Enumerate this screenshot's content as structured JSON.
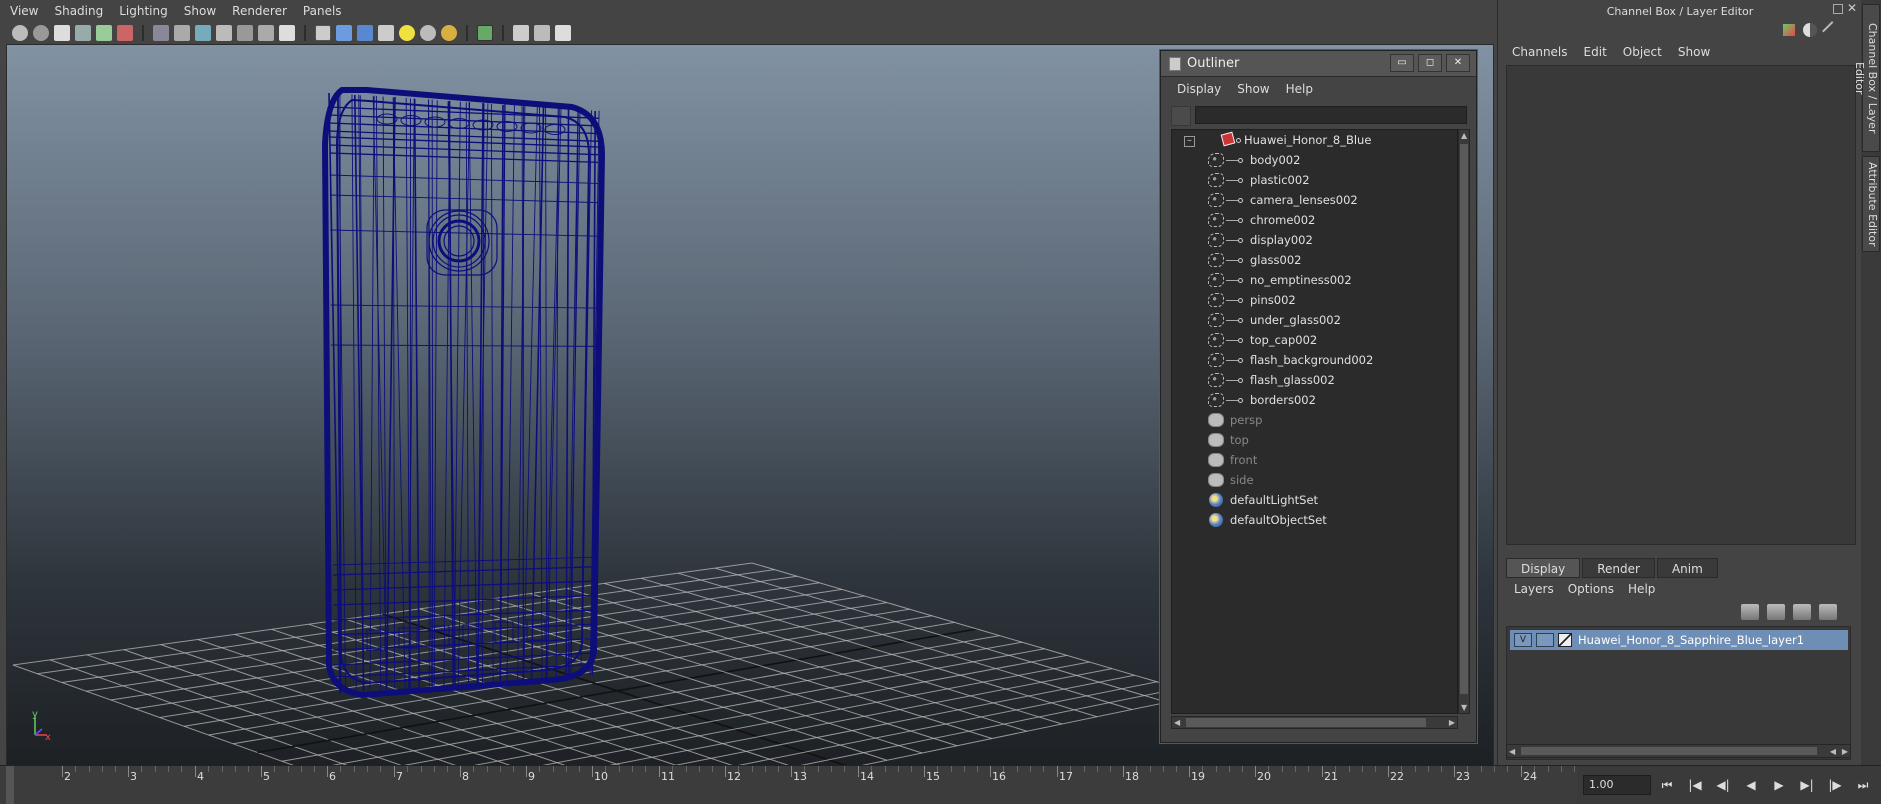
{
  "viewport": {
    "menu": [
      "View",
      "Shading",
      "Lighting",
      "Show",
      "Renderer",
      "Panels"
    ],
    "colors": {
      "wireframe": "#0d0e7a",
      "grid": "#bbbbbb",
      "grid_dark": "#111111"
    }
  },
  "outliner": {
    "title": "Outliner",
    "menu": [
      "Display",
      "Show",
      "Help"
    ],
    "search_value": "",
    "collapse_symbol": "–",
    "window_buttons": [
      "▭",
      "◻",
      "✕"
    ],
    "root": "Huawei_Honor_8_Blue",
    "children": [
      "body002",
      "plastic002",
      "camera_lenses002",
      "chrome002",
      "display002",
      "glass002",
      "no_emptiness002",
      "pins002",
      "under_glass002",
      "top_cap002",
      "flash_background002",
      "flash_glass002",
      "borders002"
    ],
    "cameras": [
      "persp",
      "top",
      "front",
      "side"
    ],
    "sets": [
      "defaultLightSet",
      "defaultObjectSet"
    ]
  },
  "channel_box": {
    "title": "Channel Box / Layer Editor",
    "menu": [
      "Channels",
      "Edit",
      "Object",
      "Show"
    ],
    "tabs": [
      "Display",
      "Render",
      "Anim"
    ],
    "layer_menu": [
      "Layers",
      "Options",
      "Help"
    ],
    "layer": {
      "visibility": "V",
      "name": "Huawei_Honor_8_Sapphire_Blue_layer1"
    }
  },
  "side_tabs": [
    "Channel Box / Layer Editor",
    "Attribute Editor"
  ],
  "timeline": {
    "ticks": [
      2,
      3,
      4,
      5,
      6,
      7,
      8,
      9,
      10,
      11,
      12,
      13,
      14,
      15,
      16,
      17,
      18,
      19,
      20,
      21,
      22,
      23,
      24
    ],
    "current_time": "1.00",
    "controls": [
      "⏮",
      "|◀",
      "◀|",
      "◀",
      "▶",
      "▶|",
      "|▶",
      "⏭"
    ]
  }
}
